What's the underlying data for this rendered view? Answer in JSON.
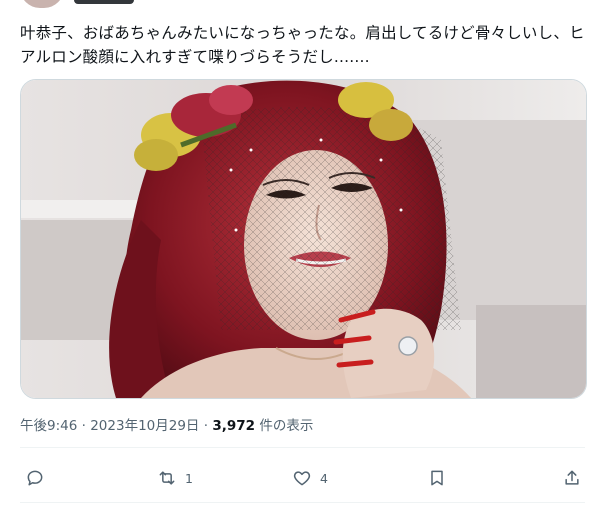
{
  "tweet": {
    "text": "叶恭子、おばあちゃんみたいになっちゃったな。肩出してるけど骨々しいし、ヒアルロン酸顔に入れすぎて喋りづらそうだし......."
  },
  "meta": {
    "time": "午後9:46",
    "dot1": "·",
    "date": "2023年10月29日",
    "dot2": "·",
    "views": "3,972",
    "views_suffix": "件の表示"
  },
  "actions": {
    "reply_icon": "reply-icon",
    "retweet_icon": "retweet-icon",
    "retweet_count": "1",
    "like_icon": "heart-icon",
    "like_count": "4",
    "bookmark_icon": "bookmark-icon",
    "share_icon": "share-icon"
  },
  "colors": {
    "text": "#0f1419",
    "secondary": "#536471",
    "border": "#cfd9de"
  }
}
